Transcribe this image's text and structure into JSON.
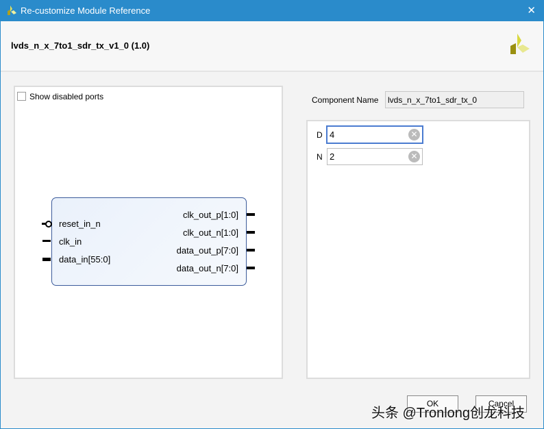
{
  "title": "Re-customize Module Reference",
  "module_title": "lvds_n_x_7to1_sdr_tx_v1_0 (1.0)",
  "show_disabled_ports": "Show disabled ports",
  "inputs": [
    "reset_in_n",
    "clk_in",
    "data_in[55:0]"
  ],
  "outputs": [
    "clk_out_p[1:0]",
    "clk_out_n[1:0]",
    "data_out_p[7:0]",
    "data_out_n[7:0]"
  ],
  "component_name_label": "Component Name",
  "component_name": "lvds_n_x_7to1_sdr_tx_0",
  "params": [
    {
      "label": "D",
      "value": "4"
    },
    {
      "label": "N",
      "value": "2"
    }
  ],
  "ok": "OK",
  "cancel": "Cancel",
  "watermark": "头条 @Tronlong创龙科技"
}
